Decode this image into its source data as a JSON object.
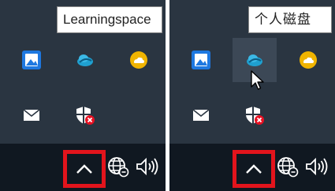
{
  "panels": [
    {
      "tooltip": "Learningspace"
    },
    {
      "tooltip": "个人磁盘"
    }
  ],
  "tray_icons": [
    "photos-icon",
    "cloud-drive-icon",
    "onedrive-cloud-icon",
    "mail-icon",
    "security-warning-icon"
  ],
  "taskbar_icons": [
    "show-hidden-icons-chevron",
    "network-icon",
    "volume-icon"
  ],
  "colors": {
    "flyout_bg": "#2a3541",
    "taskbar_bg": "#101821",
    "highlight_box": "#e3141c",
    "onedrive_yellow": "#f0b400"
  }
}
